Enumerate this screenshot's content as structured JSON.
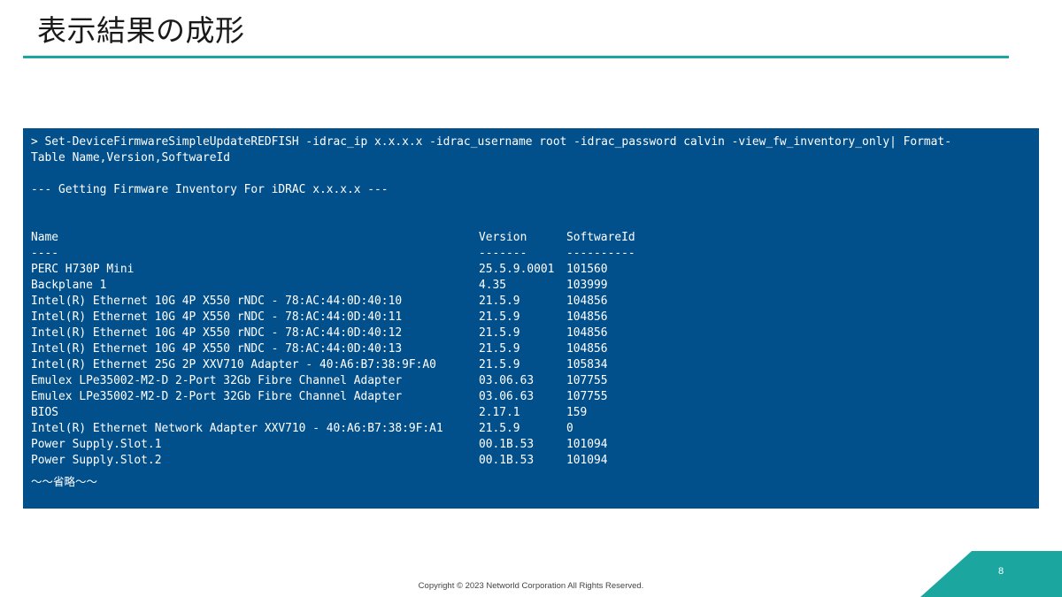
{
  "slide": {
    "title": "表示結果の成形",
    "accent_color": "#1ba7a0",
    "footer": "Copyright © 2023 Networld Corporation All Rights Reserved.",
    "page_number": "8"
  },
  "console": {
    "background_color": "#02508b",
    "command_lines": [
      "> Set-DeviceFirmwareSimpleUpdateREDFISH -idrac_ip x.x.x.x -idrac_username root -idrac_password calvin -view_fw_inventory_only| Format-",
      "Table Name,Version,SoftwareId"
    ],
    "status_line": "--- Getting Firmware Inventory For iDRAC x.x.x.x ---",
    "table": {
      "headers": {
        "name": "Name",
        "version": "Version",
        "software_id": "SoftwareId"
      },
      "underlines": {
        "name": "----",
        "version": "-------",
        "software_id": "----------"
      },
      "rows": [
        {
          "name": "PERC H730P Mini",
          "version": "25.5.9.0001",
          "software_id": "101560"
        },
        {
          "name": "Backplane 1",
          "version": "4.35",
          "software_id": "103999"
        },
        {
          "name": "Intel(R) Ethernet 10G 4P X550 rNDC - 78:AC:44:0D:40:10",
          "version": "21.5.9",
          "software_id": "104856"
        },
        {
          "name": "Intel(R) Ethernet 10G 4P X550 rNDC - 78:AC:44:0D:40:11",
          "version": "21.5.9",
          "software_id": "104856"
        },
        {
          "name": "Intel(R) Ethernet 10G 4P X550 rNDC - 78:AC:44:0D:40:12",
          "version": "21.5.9",
          "software_id": "104856"
        },
        {
          "name": "Intel(R) Ethernet 10G 4P X550 rNDC - 78:AC:44:0D:40:13",
          "version": "21.5.9",
          "software_id": "104856"
        },
        {
          "name": "Intel(R) Ethernet 25G 2P XXV710 Adapter - 40:A6:B7:38:9F:A0",
          "version": "21.5.9",
          "software_id": "105834"
        },
        {
          "name": "Emulex LPe35002-M2-D 2-Port 32Gb Fibre Channel Adapter",
          "version": "03.06.63",
          "software_id": "107755"
        },
        {
          "name": "Emulex LPe35002-M2-D 2-Port 32Gb Fibre Channel Adapter",
          "version": "03.06.63",
          "software_id": "107755"
        },
        {
          "name": "BIOS",
          "version": "2.17.1",
          "software_id": "159"
        },
        {
          "name": "Intel(R) Ethernet Network Adapter XXV710 - 40:A6:B7:38:9F:A1",
          "version": "21.5.9",
          "software_id": "0"
        },
        {
          "name": "Power Supply.Slot.1",
          "version": "00.1B.53",
          "software_id": "101094"
        },
        {
          "name": "Power Supply.Slot.2",
          "version": "00.1B.53",
          "software_id": "101094"
        }
      ]
    },
    "omitted_note": "〜〜省略〜〜"
  }
}
